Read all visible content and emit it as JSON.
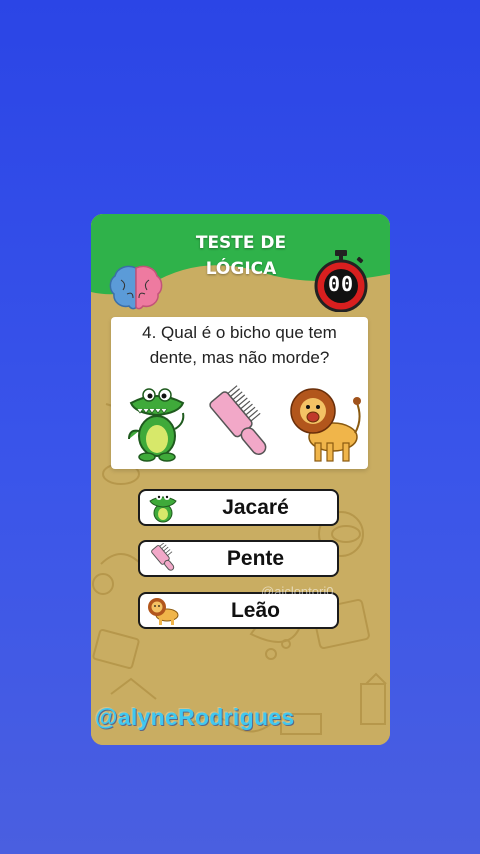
{
  "game": {
    "title_line1": "TESTE DE",
    "title_line2": "LÓGICA",
    "timer": "00",
    "question": "4. Qual é o bicho que tem dente, mas não morde?",
    "options": [
      {
        "label": "Jacaré",
        "icon": "crocodile-icon"
      },
      {
        "label": "Pente",
        "icon": "comb-icon"
      },
      {
        "label": "Leão",
        "icon": "lion-icon"
      }
    ]
  },
  "watermarks": {
    "small": "@aiclontori0",
    "big": "@alyneRodrigues"
  },
  "colors": {
    "background": "#2b45e6",
    "header_green": "#2fb24a",
    "card_sand": "#c9ad62",
    "timer_red": "#d81f1f",
    "watermark": "#40c8f0"
  }
}
